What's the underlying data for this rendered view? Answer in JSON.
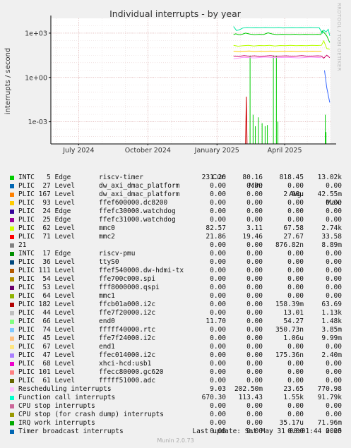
{
  "title": "Individual interrupts - by year",
  "ylabel": "interrupts / second",
  "side_label": "RRDTOOL / TOBI OETIKER",
  "munin_version": "Munin 2.0.73",
  "last_update": "Last update: Sat May 31 00:01:44 2025",
  "headers": {
    "cur": "Cur:",
    "min": "Min:",
    "avg": "Avg:",
    "max": "Max:"
  },
  "chart_data": {
    "type": "line",
    "title": "Individual interrupts - by year",
    "ylabel": "interrupts / second",
    "yscale": "log",
    "ylim": [
      3.16e-05,
      10000
    ],
    "yticks": [
      {
        "label": "1e+03",
        "value": 1000
      },
      {
        "label": "1e+00",
        "value": 1
      },
      {
        "label": "1e-03",
        "value": 0.001
      }
    ],
    "xlim": [
      "2024-05-25",
      "2025-06-01"
    ],
    "xticks": [
      {
        "label": "July 2024",
        "value": "2024-07-01"
      },
      {
        "label": "October 2024",
        "value": "2024-10-01"
      },
      {
        "label": "January 2025",
        "value": "2025-01-01"
      },
      {
        "label": "April 2025",
        "value": "2025-04-01"
      }
    ],
    "grid": true,
    "series": [
      {
        "color": "#00cc00",
        "points": [
          [
            "2025-01-23",
            800
          ],
          [
            "2025-01-26",
            900
          ],
          [
            "2025-01-30",
            780
          ],
          [
            "2025-02-03",
            820
          ],
          [
            "2025-02-08",
            1000
          ],
          [
            "2025-02-14",
            850
          ],
          [
            "2025-02-20",
            790
          ],
          [
            "2025-02-26",
            830
          ],
          [
            "2025-03-04",
            810
          ],
          [
            "2025-03-10",
            1050
          ],
          [
            "2025-03-16",
            860
          ],
          [
            "2025-03-22",
            800
          ],
          [
            "2025-03-28",
            830
          ],
          [
            "2025-04-03",
            820
          ],
          [
            "2025-04-09",
            810
          ],
          [
            "2025-04-15",
            840
          ],
          [
            "2025-04-21",
            800
          ],
          [
            "2025-04-27",
            830
          ],
          [
            "2025-05-03",
            820
          ],
          [
            "2025-05-09",
            810
          ],
          [
            "2025-05-15",
            830
          ],
          [
            "2025-05-19",
            800
          ],
          [
            "2025-05-21",
            1400
          ],
          [
            "2025-05-24",
            1000
          ],
          [
            "2025-05-27",
            650
          ],
          [
            "2025-05-31",
            230
          ]
        ]
      },
      {
        "color": "#00e6a0",
        "points": [
          [
            "2025-01-23",
            2800
          ],
          [
            "2025-01-27",
            1500
          ],
          [
            "2025-01-31",
            1700
          ],
          [
            "2025-02-04",
            2200
          ],
          [
            "2025-02-10",
            2400
          ],
          [
            "2025-02-16",
            2300
          ],
          [
            "2025-02-22",
            2350
          ],
          [
            "2025-02-28",
            2300
          ],
          [
            "2025-03-06",
            2400
          ],
          [
            "2025-03-12",
            2350
          ],
          [
            "2025-03-18",
            2300
          ],
          [
            "2025-03-24",
            2400
          ],
          [
            "2025-03-30",
            2250
          ],
          [
            "2025-04-05",
            2300
          ],
          [
            "2025-04-11",
            2350
          ],
          [
            "2025-04-17",
            2300
          ],
          [
            "2025-04-23",
            2350
          ],
          [
            "2025-04-29",
            2300
          ],
          [
            "2025-05-05",
            2400
          ],
          [
            "2025-05-11",
            2350
          ],
          [
            "2025-05-17",
            2300
          ],
          [
            "2025-05-21",
            1000
          ],
          [
            "2025-05-23",
            1600
          ],
          [
            "2025-05-26",
            1200
          ],
          [
            "2025-05-29",
            1800
          ],
          [
            "2025-05-31",
            670
          ]
        ]
      },
      {
        "color": "#b8ff00",
        "points": [
          [
            "2025-01-23",
            150
          ],
          [
            "2025-01-29",
            130
          ],
          [
            "2025-02-05",
            140
          ],
          [
            "2025-02-12",
            150
          ],
          [
            "2025-02-19",
            135
          ],
          [
            "2025-02-26",
            145
          ],
          [
            "2025-03-05",
            140
          ],
          [
            "2025-03-12",
            150
          ],
          [
            "2025-03-19",
            135
          ],
          [
            "2025-03-26",
            145
          ],
          [
            "2025-04-02",
            140
          ],
          [
            "2025-04-09",
            150
          ],
          [
            "2025-04-16",
            140
          ],
          [
            "2025-04-23",
            145
          ],
          [
            "2025-04-30",
            140
          ],
          [
            "2025-05-07",
            150
          ],
          [
            "2025-05-14",
            145
          ],
          [
            "2025-05-20",
            150
          ],
          [
            "2025-05-23",
            300
          ],
          [
            "2025-05-27",
            90
          ],
          [
            "2025-05-31",
            82
          ]
        ]
      },
      {
        "color": "#ffcc00",
        "points": [
          [
            "2025-01-23",
            60
          ],
          [
            "2025-01-30",
            55
          ],
          [
            "2025-02-06",
            58
          ],
          [
            "2025-02-13",
            62
          ],
          [
            "2025-02-20",
            55
          ],
          [
            "2025-02-27",
            60
          ],
          [
            "2025-03-06",
            57
          ],
          [
            "2025-03-13",
            61
          ],
          [
            "2025-03-20",
            56
          ],
          [
            "2025-03-27",
            59
          ],
          [
            "2025-04-03",
            58
          ],
          [
            "2025-04-10",
            60
          ],
          [
            "2025-04-17",
            57
          ],
          [
            "2025-04-24",
            59
          ],
          [
            "2025-05-01",
            58
          ],
          [
            "2025-05-08",
            60
          ],
          [
            "2025-05-15",
            58
          ],
          [
            "2025-05-20",
            60
          ]
        ]
      },
      {
        "color": "#cc0066",
        "points": [
          [
            "2025-01-23",
            28
          ],
          [
            "2025-01-30",
            26
          ],
          [
            "2025-02-06",
            30
          ],
          [
            "2025-02-13",
            27
          ],
          [
            "2025-02-20",
            29
          ],
          [
            "2025-02-27",
            26
          ],
          [
            "2025-03-06",
            28
          ],
          [
            "2025-03-13",
            30
          ],
          [
            "2025-03-20",
            27
          ],
          [
            "2025-03-27",
            28
          ],
          [
            "2025-04-03",
            29
          ],
          [
            "2025-04-10",
            27
          ],
          [
            "2025-04-17",
            28
          ],
          [
            "2025-04-24",
            30
          ],
          [
            "2025-05-01",
            27
          ],
          [
            "2025-05-08",
            28
          ],
          [
            "2025-05-15",
            29
          ],
          [
            "2025-05-20",
            28
          ],
          [
            "2025-05-23",
            20
          ],
          [
            "2025-05-27",
            32
          ],
          [
            "2025-05-31",
            22
          ]
        ]
      },
      {
        "color": "#ff99ff",
        "points": [
          [
            "2025-01-23",
            18
          ],
          [
            "2025-02-05",
            23
          ],
          [
            "2025-02-20",
            21
          ],
          [
            "2025-03-05",
            24
          ],
          [
            "2025-03-20",
            22
          ],
          [
            "2025-04-05",
            23
          ],
          [
            "2025-04-20",
            21
          ],
          [
            "2025-05-05",
            24
          ],
          [
            "2025-05-20",
            22
          ]
        ]
      },
      {
        "color": "#3366ff",
        "points": [
          [
            "2025-05-24",
            3
          ],
          [
            "2025-05-27",
            0.2
          ],
          [
            "2025-05-31",
            0.02
          ]
        ]
      },
      {
        "color": "#cc0000",
        "points": [
          [
            "2025-02-08",
            3.16e-05
          ],
          [
            "2025-02-09",
            0.05
          ],
          [
            "2025-02-10",
            3.16e-05
          ]
        ]
      }
    ],
    "spikes": [
      {
        "color": "#00cc00",
        "date": "2025-02-14",
        "top": 30
      },
      {
        "color": "#00cc00",
        "date": "2025-02-18",
        "top": 0.003
      },
      {
        "color": "#00cc00",
        "date": "2025-02-21",
        "top": 0.0005
      },
      {
        "color": "#00cc00",
        "date": "2025-02-25",
        "top": 0.002
      },
      {
        "color": "#00cc00",
        "date": "2025-03-02",
        "top": 0.0008
      },
      {
        "color": "#00cc00",
        "date": "2025-03-06",
        "top": 0.0005
      },
      {
        "color": "#00cc00",
        "date": "2025-03-09",
        "top": 0.0006
      },
      {
        "color": "#00cc00",
        "date": "2025-03-17",
        "top": 30
      },
      {
        "color": "#00cc00",
        "date": "2025-03-21",
        "top": 30
      },
      {
        "color": "#00cc00",
        "date": "2025-03-23",
        "top": 0.001
      },
      {
        "color": "#00cc00",
        "date": "2025-05-25",
        "top": 0.003
      },
      {
        "color": "#00cc00",
        "date": "2025-05-26",
        "top": 0.0002
      }
    ]
  },
  "legend": [
    {
      "color": "#00cc00",
      "source": "INTC   5 Edge",
      "device": "riscv-timer",
      "cur": "231.20",
      "min": "80.16",
      "avg": "818.45",
      "max": "13.02k"
    },
    {
      "color": "#0066b3",
      "source": "PLIC  27 Level",
      "device": "dw_axi_dmac_platform",
      "cur": "0.00",
      "min": "0.00",
      "avg": "0.00",
      "max": "0.00"
    },
    {
      "color": "#ff8000",
      "source": "PLIC 167 Level",
      "device": "dw_axi_dmac_platform",
      "cur": "0.00",
      "min": "0.00",
      "avg": "2.98u",
      "max": "42.55m"
    },
    {
      "color": "#ffcc00",
      "source": "PLIC  93 Level",
      "device": "ffef600000.dc8200",
      "cur": "0.00",
      "min": "0.00",
      "avg": "0.00",
      "max": "0.00"
    },
    {
      "color": "#330099",
      "source": "PLIC  24 Edge",
      "device": "ffefc30000.watchdog",
      "cur": "0.00",
      "min": "0.00",
      "avg": "0.00",
      "max": "0.00"
    },
    {
      "color": "#990099",
      "source": "PLIC  25 Edge",
      "device": "ffefc31000.watchdog",
      "cur": "0.00",
      "min": "0.00",
      "avg": "0.00",
      "max": "0.00"
    },
    {
      "color": "#ccff00",
      "source": "PLIC  62 Level",
      "device": "mmc0",
      "cur": "82.57",
      "min": "3.11",
      "avg": "67.58",
      "max": "2.74k"
    },
    {
      "color": "#ff0000",
      "source": "PLIC  71 Level",
      "device": "mmc2",
      "cur": "21.86",
      "min": "19.46",
      "avg": "27.67",
      "max": "33.58"
    },
    {
      "color": "#808080",
      "source": "21",
      "device": "",
      "cur": "0.00",
      "min": "0.00",
      "avg": "876.82n",
      "max": "8.89m"
    },
    {
      "color": "#008f00",
      "source": "INTC  17 Edge",
      "device": "riscv-pmu",
      "cur": "0.00",
      "min": "0.00",
      "avg": "0.00",
      "max": "0.00"
    },
    {
      "color": "#00487d",
      "source": "PLIC  36 Level",
      "device": "ttyS0",
      "cur": "0.00",
      "min": "0.00",
      "avg": "0.00",
      "max": "0.00"
    },
    {
      "color": "#b35a00",
      "source": "PLIC 111 Level",
      "device": "ffef540000.dw-hdmi-tx",
      "cur": "0.00",
      "min": "0.00",
      "avg": "0.00",
      "max": "0.00"
    },
    {
      "color": "#b38f00",
      "source": "PLIC  54 Level",
      "device": "ffe700c000.spi",
      "cur": "0.00",
      "min": "0.00",
      "avg": "0.00",
      "max": "0.00"
    },
    {
      "color": "#6b006b",
      "source": "PLIC  53 Level",
      "device": "fff8000000.qspi",
      "cur": "0.00",
      "min": "0.00",
      "avg": "0.00",
      "max": "0.00"
    },
    {
      "color": "#8fb300",
      "source": "PLIC  64 Level",
      "device": "mmc1",
      "cur": "0.00",
      "min": "0.00",
      "avg": "0.00",
      "max": "0.00"
    },
    {
      "color": "#b30000",
      "source": "PLIC 182 Level",
      "device": "ffcb01a000.i2c",
      "cur": "0.00",
      "min": "0.00",
      "avg": "158.39m",
      "max": "63.69"
    },
    {
      "color": "#bebebe",
      "source": "PLIC  44 Level",
      "device": "ffe7f20000.i2c",
      "cur": "0.00",
      "min": "0.00",
      "avg": "13.01",
      "max": "1.13k"
    },
    {
      "color": "#80ff80",
      "source": "PLIC  66 Level",
      "device": "end0",
      "cur": "11.70",
      "min": "0.00",
      "avg": "54.27",
      "max": "1.48k"
    },
    {
      "color": "#80c9ff",
      "source": "PLIC  74 Level",
      "device": "fffff40000.rtc",
      "cur": "0.00",
      "min": "0.00",
      "avg": "350.73n",
      "max": "3.85m"
    },
    {
      "color": "#ffc080",
      "source": "PLIC  45 Level",
      "device": "ffe7f24000.i2c",
      "cur": "0.00",
      "min": "0.00",
      "avg": "1.06u",
      "max": "9.99m"
    },
    {
      "color": "#ffe680",
      "source": "PLIC  67 Level",
      "device": "end1",
      "cur": "0.00",
      "min": "0.00",
      "avg": "0.00",
      "max": "0.00"
    },
    {
      "color": "#aa80ff",
      "source": "PLIC  47 Level",
      "device": "ffec014000.i2c",
      "cur": "0.00",
      "min": "0.00",
      "avg": "175.36n",
      "max": "2.40m"
    },
    {
      "color": "#ee00cc",
      "source": "PLIC  68 Level",
      "device": "xhci-hcd:usb1",
      "cur": "0.00",
      "min": "0.00",
      "avg": "0.00",
      "max": "0.00"
    },
    {
      "color": "#ff8080",
      "source": "PLIC 101 Level",
      "device": "ffecc80000.gc620",
      "cur": "0.00",
      "min": "0.00",
      "avg": "0.00",
      "max": "0.00"
    },
    {
      "color": "#666600",
      "source": "PLIC  61 Level",
      "device": "fffff51000.adc",
      "cur": "0.00",
      "min": "0.00",
      "avg": "0.00",
      "max": "0.00"
    },
    {
      "color": "#ffbfff",
      "source": "Rescheduling interrupts",
      "device": "",
      "cur": "9.03",
      "min": "202.50m",
      "avg": "23.65",
      "max": "770.98"
    },
    {
      "color": "#00ffcc",
      "source": "Function call interrupts",
      "device": "",
      "cur": "670.30",
      "min": "113.43",
      "avg": "1.55k",
      "max": "91.79k"
    },
    {
      "color": "#cc6699",
      "source": "CPU stop interrupts",
      "device": "",
      "cur": "0.00",
      "min": "0.00",
      "avg": "0.00",
      "max": "0.00"
    },
    {
      "color": "#999900",
      "source": "CPU stop (for crash dump) interrupts",
      "device": "",
      "cur": "0.00",
      "min": "0.00",
      "avg": "0.00",
      "max": "0.00"
    },
    {
      "color": "#00aa00",
      "source": "IRQ work interrupts",
      "device": "",
      "cur": "0.00",
      "min": "0.00",
      "avg": "35.17u",
      "max": "71.96m"
    },
    {
      "color": "#0066b3",
      "source": "Timer broadcast interrupts",
      "device": "",
      "cur": "0.00",
      "min": "0.00",
      "avg": "0.00",
      "max": "0.00"
    }
  ]
}
